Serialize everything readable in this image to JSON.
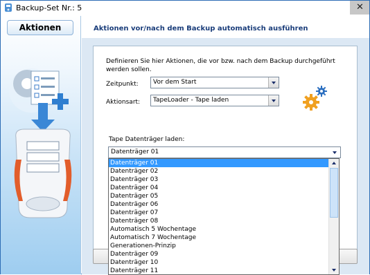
{
  "window": {
    "title": "Backup-Set Nr.: 5",
    "close_symbol": "✕"
  },
  "sidebar": {
    "tab_label": "Aktionen"
  },
  "header": {
    "title": "Aktionen vor/nach dem Backup automatisch ausführen"
  },
  "form": {
    "description": "Definieren Sie hier Aktionen, die vor bzw. nach dem Backup durchgeführt werden sollen.",
    "zeitpunkt_label": "Zeitpunkt:",
    "zeitpunkt_value": "Vor dem Start",
    "aktionsart_label": "Aktionsart:",
    "aktionsart_value": "TapeLoader - Tape laden",
    "tape_label": "Tape Datenträger laden:",
    "tape_value": "Datenträger 01"
  },
  "dropdown": {
    "selected_index": 0,
    "options": [
      "Datenträger 01",
      "Datenträger 02",
      "Datenträger 03",
      "Datenträger 04",
      "Datenträger 05",
      "Datenträger 06",
      "Datenträger 07",
      "Datenträger 08",
      "Automatisch 5 Wochentage",
      "Automatisch 7 Wochentage",
      "Generationen-Prinzip",
      "Datenträger 09",
      "Datenträger 10",
      "Datenträger 11"
    ]
  },
  "colors": {
    "accent": "#3399ff",
    "header_text": "#1a3d7a",
    "panel_bg": "#dce8f4"
  }
}
